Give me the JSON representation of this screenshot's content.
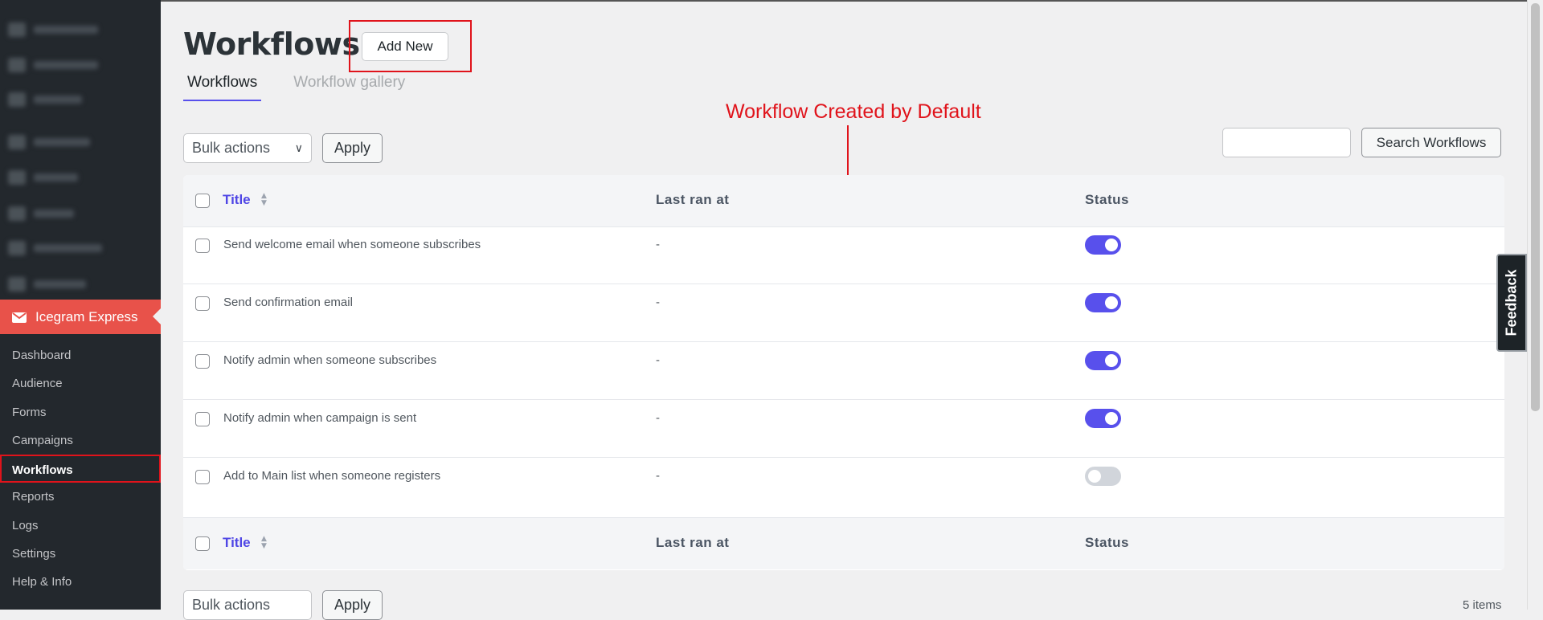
{
  "sidebar": {
    "plugin_label": "Icegram Express",
    "items": [
      {
        "label": "Dashboard"
      },
      {
        "label": "Audience"
      },
      {
        "label": "Forms"
      },
      {
        "label": "Campaigns"
      },
      {
        "label": "Workflows"
      },
      {
        "label": "Reports"
      },
      {
        "label": "Logs"
      },
      {
        "label": "Settings"
      },
      {
        "label": "Help & Info"
      }
    ],
    "active_item": "Workflows"
  },
  "header": {
    "title": "Workflows",
    "add_new_label": "Add New"
  },
  "tabs": [
    {
      "label": "Workflows"
    },
    {
      "label": "Workflow gallery"
    }
  ],
  "annotation": {
    "text": "Workflow Created by Default"
  },
  "toolbar": {
    "bulk_actions_label": "Bulk actions",
    "apply_label": "Apply",
    "search_value": "",
    "search_button_label": "Search Workflows"
  },
  "table": {
    "headers": {
      "title": "Title",
      "last_ran_at": "Last ran at",
      "status": "Status"
    },
    "rows": [
      {
        "title": "Send welcome email when someone subscribes",
        "last_ran_at": "-",
        "status": "active"
      },
      {
        "title": "Send confirmation email",
        "last_ran_at": "-",
        "status": "active"
      },
      {
        "title": "Notify admin when someone subscribes",
        "last_ran_at": "-",
        "status": "active"
      },
      {
        "title": "Notify admin when campaign is sent",
        "last_ran_at": "-",
        "status": "active"
      },
      {
        "title": "Add to Main list when someone registers",
        "last_ran_at": "-",
        "status": "inactive"
      }
    ]
  },
  "footer": {
    "items_count": "5 items"
  },
  "feedback_label": "Feedback",
  "colors": {
    "accent": "#5850ec",
    "plugin_menu": "#e8524a",
    "highlight": "#e0131b",
    "sidebar_bg": "#23282d"
  }
}
